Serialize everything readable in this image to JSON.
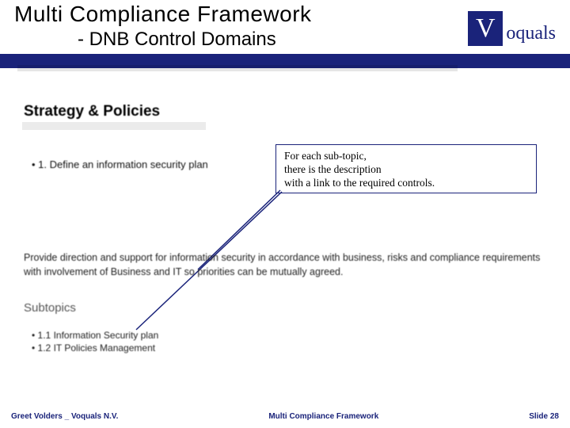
{
  "header": {
    "title": "Multi Compliance Framework",
    "subtitle": "- DNB Control Domains"
  },
  "logo": {
    "box_letter": "V",
    "word": "oquals"
  },
  "section_heading": "Strategy & Policies",
  "item_1": "1. Define an information security plan",
  "callout": {
    "line1": "For each sub-topic,",
    "line2": "there is the description",
    "line3": "with a link to the required controls."
  },
  "description_para": "Provide direction and support for information security in accordance with business, risks and compliance requirements with involvement of Business and IT so priorities can be mutually agreed.",
  "subtopics_heading": "Subtopics",
  "subtopics": {
    "s1": "1.1 Information Security plan",
    "s2": "1.2 IT Policies Management"
  },
  "footer": {
    "left": "Greet Volders _ Voquals N.V.",
    "center": "Multi Compliance Framework",
    "right": "Slide 28"
  }
}
